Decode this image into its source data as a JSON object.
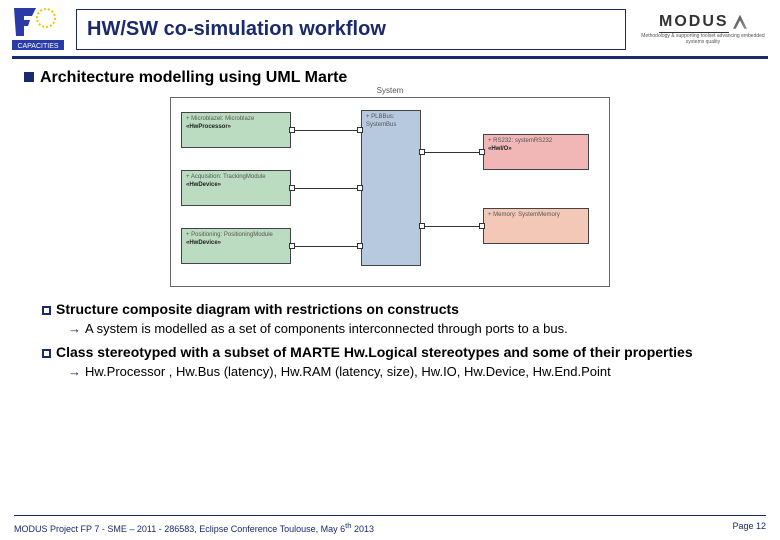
{
  "header": {
    "title": "HW/SW co-simulation workflow",
    "logo_fp7_caption": "CAPACITIES",
    "logo_modus_text": "MODUS",
    "logo_modus_sub": "Methodology & supporting toolset advancing embedded systems quality"
  },
  "heading": "Architecture modelling using UML Marte",
  "diagram": {
    "label": "System",
    "boxes": {
      "b1": {
        "st": "+ MicroblazeI: Microblaze",
        "nm": "«HwProcessor»"
      },
      "b2": {
        "st": "+ Acquisition: TrackingModule",
        "nm": "«HwDevice»"
      },
      "b3": {
        "st": "+ Positioning: PositioningModule",
        "nm": "«HwDevice»"
      },
      "b4": {
        "st": "+ PLBBus: SystemBus",
        "nm": ""
      },
      "b5": {
        "st": "+ RS232: systemRS232",
        "nm": "«HwI/O»"
      },
      "b6": {
        "st": "+ Memory: SystemMemory",
        "nm": ""
      }
    }
  },
  "bullets": {
    "b1_line": "Structure composite diagram with restrictions on constructs",
    "b1_sub": "A system is modelled as a set of components interconnected through ports to a bus.",
    "b2_line": "Class stereotyped with a subset of MARTE Hw.Logical stereotypes and some of their properties",
    "b2_sub": "Hw.Processor , Hw.Bus (latency), Hw.RAM (latency, size), Hw.IO, Hw.Device, Hw.End.Point"
  },
  "footer": {
    "left": "MODUS Project  FP 7 - SME – 2011 - 286583, Eclipse Conference  Toulouse, May 6",
    "left_sup": "th",
    "left_tail": " 2013",
    "right": "Page 12"
  }
}
